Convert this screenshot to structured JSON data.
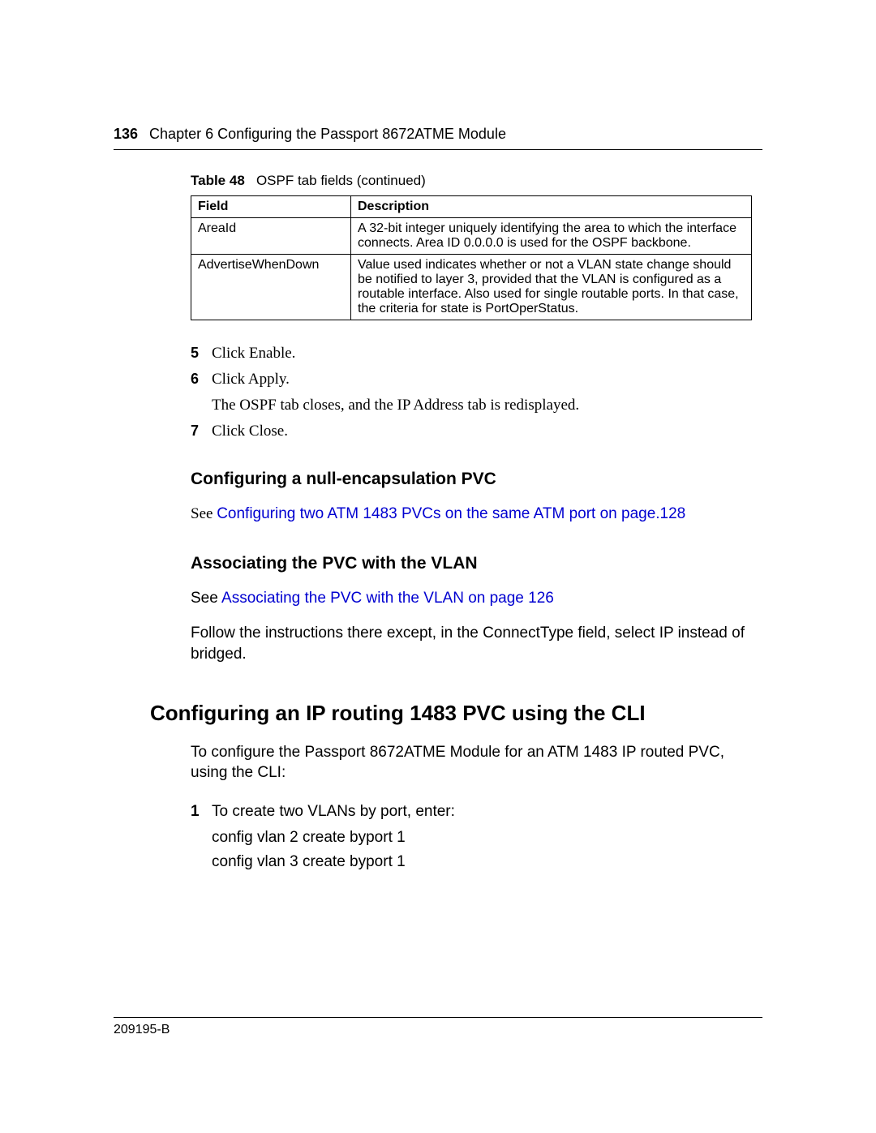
{
  "header": {
    "page_number": "136",
    "chapter": "Chapter 6  Configuring the Passport 8672ATME Module"
  },
  "table_caption": {
    "label": "Table 48",
    "text": "OSPF tab fields (continued)"
  },
  "table": {
    "headers": [
      "Field",
      "Description"
    ],
    "rows": [
      {
        "field": "AreaId",
        "description": "A 32-bit integer uniquely identifying the area to which the interface connects. Area ID 0.0.0.0 is used for the OSPF backbone."
      },
      {
        "field": "AdvertiseWhenDown",
        "description": "Value used indicates whether or not a VLAN state change should be notified to layer 3, provided that the VLAN is configured as a routable interface. Also used for single routable ports. In that case, the criteria for state is PortOperStatus."
      }
    ]
  },
  "steps_a": [
    {
      "num": "5",
      "text": "Click Enable."
    },
    {
      "num": "6",
      "text": "Click Apply."
    }
  ],
  "step_note": "The OSPF tab closes, and the IP Address tab is redisplayed.",
  "steps_b": [
    {
      "num": "7",
      "text": "Click Close."
    }
  ],
  "section1": {
    "heading": "Configuring a null-encapsulation PVC",
    "prefix": "See  ",
    "link": "Configuring two ATM 1483 PVCs on the same ATM port  on page.128"
  },
  "section2": {
    "heading": "Associating the PVC with the VLAN",
    "prefix": "See ",
    "link": "Associating the PVC with the VLAN  on page 126",
    "followup": "Follow the instructions there except, in the ConnectType field, select IP instead of bridged."
  },
  "section3": {
    "heading": "Configuring an IP routing 1483 PVC using the CLI",
    "intro": "To configure the Passport 8672ATME Module for an ATM 1483 IP routed PVC, using the CLI:",
    "step": {
      "num": "1",
      "text": "To create two VLANs by port, enter:",
      "sub1": "config vlan 2 create byport 1",
      "sub2": "config vlan 3 create byport 1"
    }
  },
  "footer": "209195-B"
}
